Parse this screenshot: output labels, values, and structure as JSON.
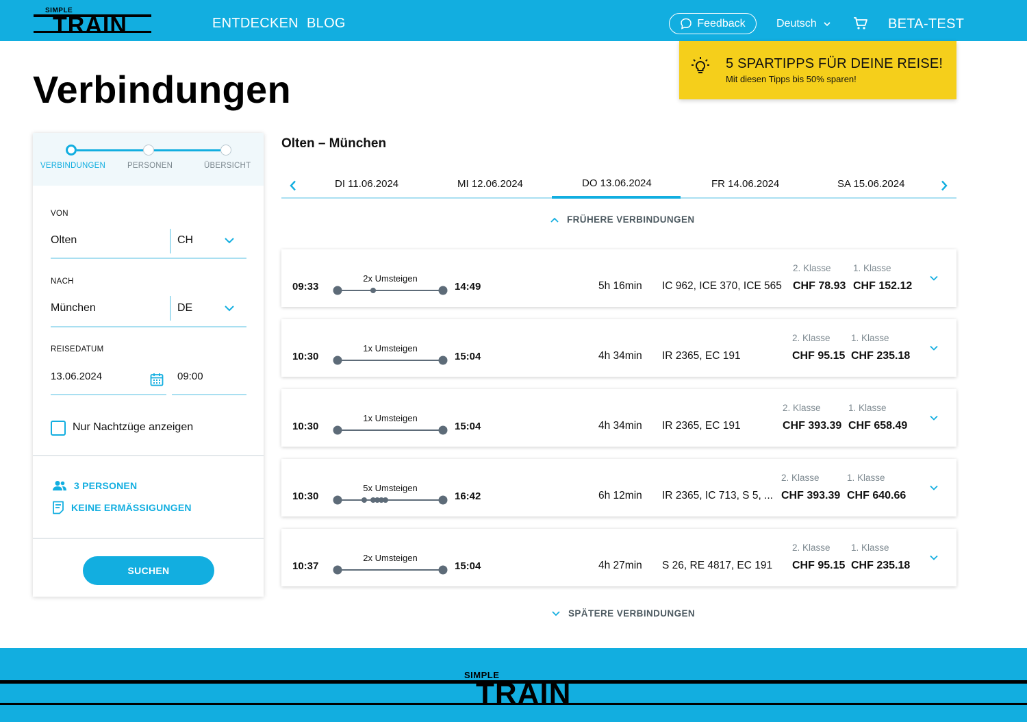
{
  "header": {
    "logo_small": "SIMPLE",
    "logo_big": "TRAIN",
    "nav": [
      "ENTDECKEN",
      "BLOG"
    ],
    "feedback_label": "Feedback",
    "language": "Deutsch",
    "beta_label": "BETA-TEST"
  },
  "page_title": "Verbindungen",
  "promo": {
    "title": "5 SPARTIPPS FÜR DEINE REISE!",
    "subtitle": "Mit diesen Tipps bis 50% sparen!"
  },
  "steps": [
    {
      "label": "VERBINDUNGEN",
      "active": true
    },
    {
      "label": "PERSONEN",
      "active": false
    },
    {
      "label": "ÜBERSICHT",
      "active": false
    }
  ],
  "search": {
    "from_label": "VON",
    "from_value": "Olten",
    "from_country": "CH",
    "to_label": "NACH",
    "to_value": "München",
    "to_country": "DE",
    "date_label": "REISEDATUM",
    "date_value": "13.06.2024",
    "time_value": "09:00",
    "night_trains_label": "Nur Nachtzüge anzeigen",
    "persons_label": "3 PERSONEN",
    "discounts_label": "KEINE ERMÄSSIGUNGEN",
    "search_button": "SUCHEN"
  },
  "results": {
    "route": "Olten – München",
    "dates": [
      "DI 11.06.2024",
      "MI 12.06.2024",
      "DO 13.06.2024",
      "FR 14.06.2024",
      "SA 15.06.2024"
    ],
    "selected_date_index": 2,
    "earlier_label": "FRÜHERE VERBINDUNGEN",
    "later_label": "SPÄTERE VERBINDUNGEN",
    "class2_label": "2. Klasse",
    "class1_label": "1. Klasse",
    "connections": [
      {
        "dep": "09:33",
        "arr": "14:49",
        "transfers": "2x Umsteigen",
        "duration": "5h 16min",
        "trains": "IC 962, ICE 370, ICE 565",
        "price2": "CHF 78.93",
        "price1": "CHF 152.12"
      },
      {
        "dep": "10:30",
        "arr": "15:04",
        "transfers": "1x Umsteigen",
        "duration": "4h 34min",
        "trains": "IR 2365, EC 191",
        "price2": "CHF 95.15",
        "price1": "CHF 235.18"
      },
      {
        "dep": "10:30",
        "arr": "15:04",
        "transfers": "1x Umsteigen",
        "duration": "4h 34min",
        "trains": "IR 2365, EC 191",
        "price2": "CHF 393.39",
        "price1": "CHF 658.49"
      },
      {
        "dep": "10:30",
        "arr": "16:42",
        "transfers": "5x Umsteigen",
        "duration": "6h 12min",
        "trains": "IR 2365, IC 713, S 5, ...",
        "price2": "CHF 393.39",
        "price1": "CHF 640.66"
      },
      {
        "dep": "10:37",
        "arr": "15:04",
        "transfers": "2x Umsteigen",
        "duration": "4h 27min",
        "trains": "S 26, RE 4817, EC 191",
        "price2": "CHF 95.15",
        "price1": "CHF 235.18"
      }
    ]
  },
  "footer": {
    "logo_small": "SIMPLE",
    "logo_big": "TRAIN"
  },
  "colors": {
    "accent": "#12aee0",
    "promo": "#f5cf1b",
    "text": "#111111"
  },
  "icons": [
    "chat-bubble-icon",
    "chevron-down-icon",
    "cart-icon",
    "lightbulb-icon",
    "calendar-icon",
    "people-icon",
    "document-icon",
    "chevron-left-icon",
    "chevron-right-icon",
    "chevron-up-icon"
  ]
}
